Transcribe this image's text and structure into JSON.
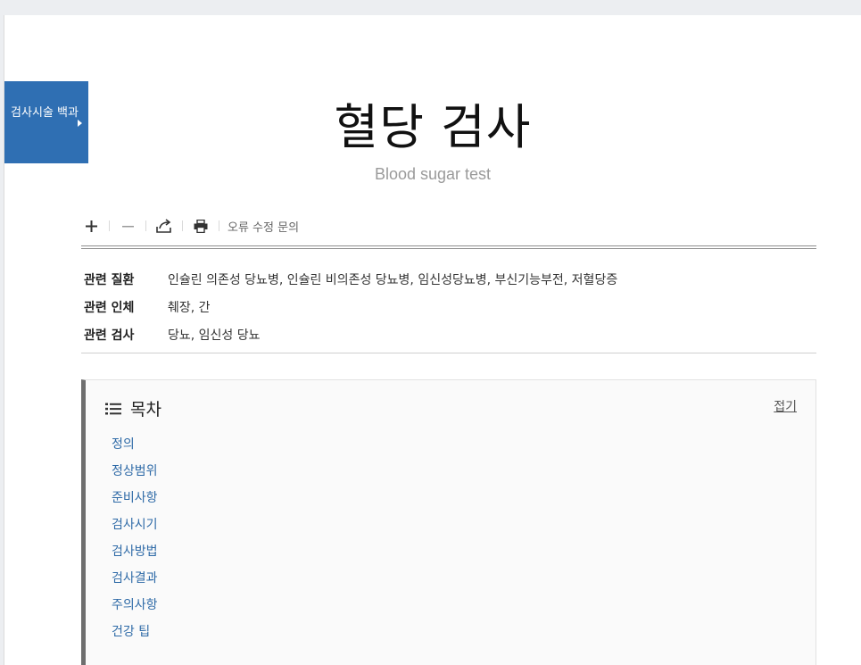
{
  "category": {
    "label": "검사시술 백과"
  },
  "article": {
    "title": "혈당 검사",
    "subtitle": "Blood sugar test"
  },
  "toolbar": {
    "zoom_in_icon": "plus-icon",
    "zoom_out_icon": "minus-icon",
    "share_icon": "share-icon",
    "print_icon": "print-icon",
    "report_label": "오류 수정 문의"
  },
  "meta": {
    "rows": [
      {
        "label": "관련 질환",
        "value": "인슐린 의존성 당뇨병, 인슐린 비의존성 당뇨병, 임신성당뇨병, 부신기능부전, 저혈당증"
      },
      {
        "label": "관련 인체",
        "value": "췌장, 간"
      },
      {
        "label": "관련 검사",
        "value": "당뇨, 임신성 당뇨"
      }
    ]
  },
  "toc": {
    "title": "목차",
    "collapse_label": "접기",
    "items": [
      "정의",
      "정상범위",
      "준비사항",
      "검사시기",
      "검사방법",
      "검사결과",
      "주의사항",
      "건강 팁"
    ]
  },
  "colors": {
    "badge_bg": "#2f6fb3",
    "link": "#2e6aa7",
    "toc_border": "#6e6e6e"
  }
}
